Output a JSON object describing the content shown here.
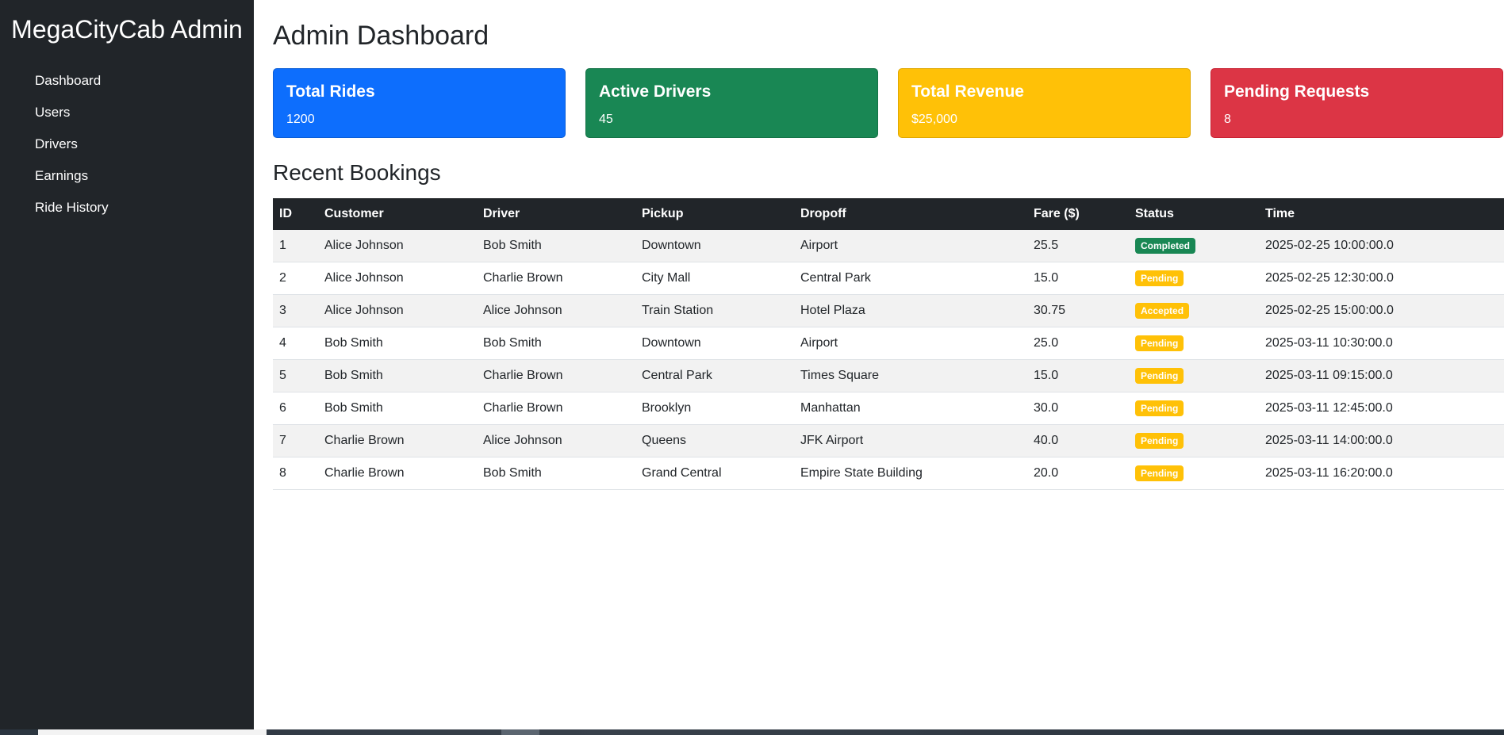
{
  "sidebar": {
    "brand": "MegaCityCab Admin",
    "items": [
      {
        "label": "Dashboard"
      },
      {
        "label": "Users"
      },
      {
        "label": "Drivers"
      },
      {
        "label": "Earnings"
      },
      {
        "label": "Ride History"
      }
    ]
  },
  "main": {
    "title": "Admin Dashboard",
    "cards": [
      {
        "title": "Total Rides",
        "value": "1200",
        "color": "#0d6efd"
      },
      {
        "title": "Active Drivers",
        "value": "45",
        "color": "#198754"
      },
      {
        "title": "Total Revenue",
        "value": "$25,000",
        "color": "#ffc107"
      },
      {
        "title": "Pending Requests",
        "value": "8",
        "color": "#dc3545"
      }
    ],
    "bookings": {
      "title": "Recent Bookings",
      "columns": [
        "ID",
        "Customer",
        "Driver",
        "Pickup",
        "Dropoff",
        "Fare ($)",
        "Status",
        "Time"
      ],
      "rows": [
        {
          "id": "1",
          "customer": "Alice Johnson",
          "driver": "Bob Smith",
          "pickup": "Downtown",
          "dropoff": "Airport",
          "fare": "25.5",
          "status": "Completed",
          "time": "2025-02-25 10:00:00.0"
        },
        {
          "id": "2",
          "customer": "Alice Johnson",
          "driver": "Charlie Brown",
          "pickup": "City Mall",
          "dropoff": "Central Park",
          "fare": "15.0",
          "status": "Pending",
          "time": "2025-02-25 12:30:00.0"
        },
        {
          "id": "3",
          "customer": "Alice Johnson",
          "driver": "Alice Johnson",
          "pickup": "Train Station",
          "dropoff": "Hotel Plaza",
          "fare": "30.75",
          "status": "Accepted",
          "time": "2025-02-25 15:00:00.0"
        },
        {
          "id": "4",
          "customer": "Bob Smith",
          "driver": "Bob Smith",
          "pickup": "Downtown",
          "dropoff": "Airport",
          "fare": "25.0",
          "status": "Pending",
          "time": "2025-03-11 10:30:00.0"
        },
        {
          "id": "5",
          "customer": "Bob Smith",
          "driver": "Charlie Brown",
          "pickup": "Central Park",
          "dropoff": "Times Square",
          "fare": "15.0",
          "status": "Pending",
          "time": "2025-03-11 09:15:00.0"
        },
        {
          "id": "6",
          "customer": "Bob Smith",
          "driver": "Charlie Brown",
          "pickup": "Brooklyn",
          "dropoff": "Manhattan",
          "fare": "30.0",
          "status": "Pending",
          "time": "2025-03-11 12:45:00.0"
        },
        {
          "id": "7",
          "customer": "Charlie Brown",
          "driver": "Alice Johnson",
          "pickup": "Queens",
          "dropoff": "JFK Airport",
          "fare": "40.0",
          "status": "Pending",
          "time": "2025-03-11 14:00:00.0"
        },
        {
          "id": "8",
          "customer": "Charlie Brown",
          "driver": "Bob Smith",
          "pickup": "Grand Central",
          "dropoff": "Empire State Building",
          "fare": "20.0",
          "status": "Pending",
          "time": "2025-03-11 16:20:00.0"
        }
      ]
    }
  },
  "colors": {
    "sidebar_bg": "#212529",
    "status_completed": "#198754",
    "status_pending": "#ffc107",
    "status_accepted": "#ffc107"
  }
}
